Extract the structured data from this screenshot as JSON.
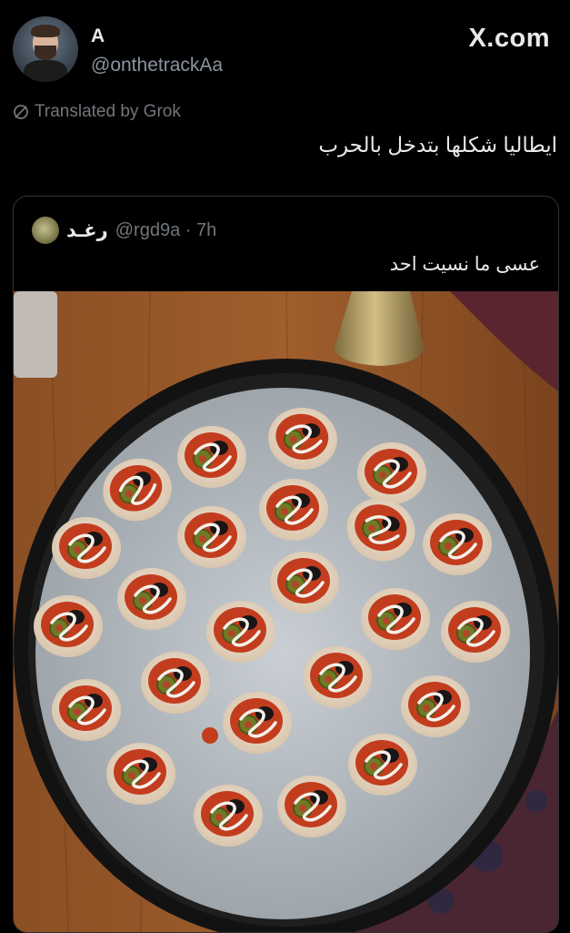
{
  "author": {
    "name": "A",
    "handle": "@onthetrackAa"
  },
  "site_label": "X.com",
  "translation_note": "Translated by Grok",
  "tweet_text": "ايطاليا شكلها بتدخل بالحرب",
  "quoted": {
    "name": "رغـد",
    "handle_time": "@rgd9a · 7h",
    "text": "عسى ما نسيت احد"
  },
  "colors": {
    "background": "#000000",
    "text": "#e7e9ea",
    "muted": "#71767b",
    "border": "#2f3336"
  },
  "icons": {
    "translate": "grok-icon"
  }
}
